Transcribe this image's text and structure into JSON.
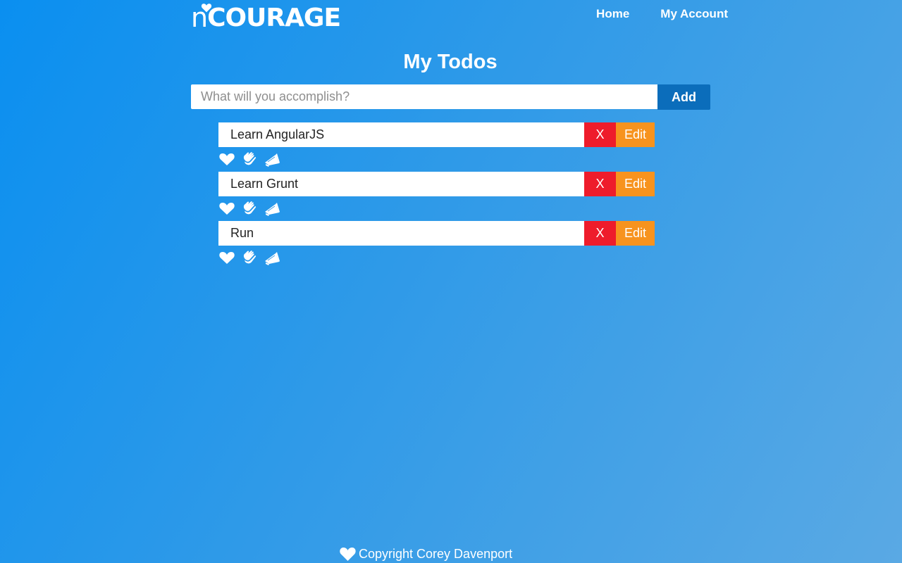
{
  "header": {
    "logo_text_n": "n",
    "logo_text_rest": "COURAGE",
    "nav": [
      {
        "label": "Home"
      },
      {
        "label": "My Account"
      }
    ]
  },
  "main": {
    "title": "My Todos",
    "add_input": {
      "placeholder": "What will you accomplish?",
      "value": ""
    },
    "add_button_label": "Add",
    "todos": [
      {
        "text": "Learn AngularJS",
        "delete_label": "X",
        "edit_label": "Edit"
      },
      {
        "text": "Learn Grunt",
        "delete_label": "X",
        "edit_label": "Edit"
      },
      {
        "text": "Run",
        "delete_label": "X",
        "edit_label": "Edit"
      }
    ],
    "todo_action_icons": [
      "heart-icon",
      "clap-icon",
      "megaphone-icon"
    ]
  },
  "footer": {
    "icon": "heart-icon",
    "text": "Copyright Corey Davenport"
  },
  "colors": {
    "background_start": "#0a8ff0",
    "background_end": "#5aa9e4",
    "add_button": "#0b6dbb",
    "delete_button": "#ee1c2b",
    "edit_button": "#f7931e"
  }
}
